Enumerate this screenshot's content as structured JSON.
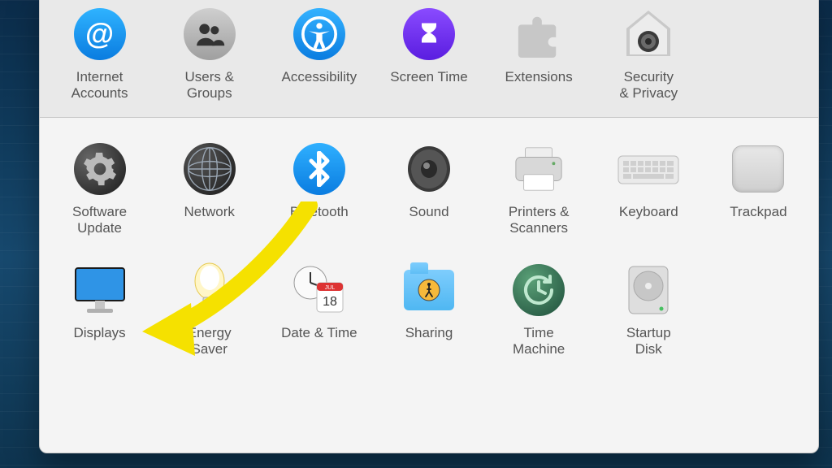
{
  "rows": {
    "top": [
      {
        "id": "internet-accounts",
        "label": "Internet\nAccounts"
      },
      {
        "id": "users-groups",
        "label": "Users &\nGroups"
      },
      {
        "id": "accessibility",
        "label": "Accessibility"
      },
      {
        "id": "screen-time",
        "label": "Screen Time"
      },
      {
        "id": "extensions",
        "label": "Extensions"
      },
      {
        "id": "security-privacy",
        "label": "Security\n& Privacy"
      }
    ],
    "mid": [
      {
        "id": "software-update",
        "label": "Software\nUpdate"
      },
      {
        "id": "network",
        "label": "Network"
      },
      {
        "id": "bluetooth",
        "label": "Bluetooth"
      },
      {
        "id": "sound",
        "label": "Sound"
      },
      {
        "id": "printers-scanners",
        "label": "Printers &\nScanners"
      },
      {
        "id": "keyboard",
        "label": "Keyboard"
      },
      {
        "id": "trackpad",
        "label": "Trackpad"
      }
    ],
    "bot": [
      {
        "id": "displays",
        "label": "Displays"
      },
      {
        "id": "energy-saver",
        "label": "Energy\nSaver"
      },
      {
        "id": "date-time",
        "label": "Date & Time"
      },
      {
        "id": "sharing",
        "label": "Sharing"
      },
      {
        "id": "time-machine",
        "label": "Time\nMachine"
      },
      {
        "id": "startup-disk",
        "label": "Startup\nDisk"
      }
    ]
  },
  "date_icon": {
    "month": "JUL",
    "day": "18"
  },
  "annotation": {
    "target": "displays",
    "color": "#f5e100"
  }
}
